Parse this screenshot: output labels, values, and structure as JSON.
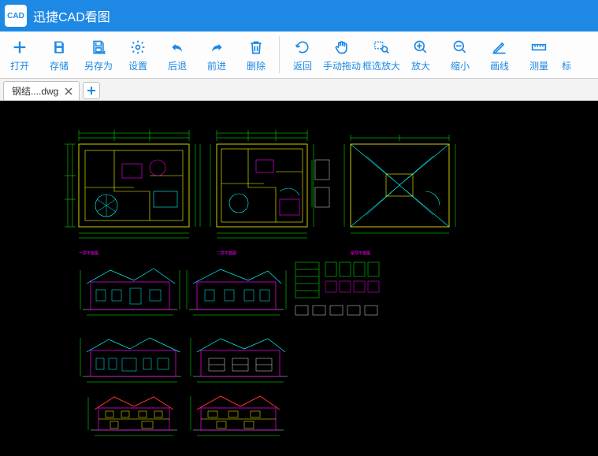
{
  "app": {
    "title": "迅捷CAD看图",
    "logo_text": "CAD"
  },
  "toolbar": {
    "open": "打开",
    "save": "存储",
    "saveas": "另存为",
    "settings": "设置",
    "back": "后退",
    "forward": "前进",
    "delete": "删除",
    "return": "返回",
    "pan": "手动拖动",
    "zoomwindow": "框选放大",
    "zoomin": "放大",
    "zoomout": "缩小",
    "drawline": "画线",
    "measure": "测量",
    "more": "标"
  },
  "tabs": {
    "items": [
      {
        "label": "钢结....dwg"
      }
    ]
  },
  "colors": {
    "accent": "#1e88e5",
    "canvas_bg": "#000000",
    "cad_green": "#00ff00",
    "cad_magenta": "#ff00ff",
    "cad_cyan": "#00ffff",
    "cad_yellow": "#ffff00",
    "cad_red": "#ff3030",
    "cad_white": "#e0e0e0"
  }
}
